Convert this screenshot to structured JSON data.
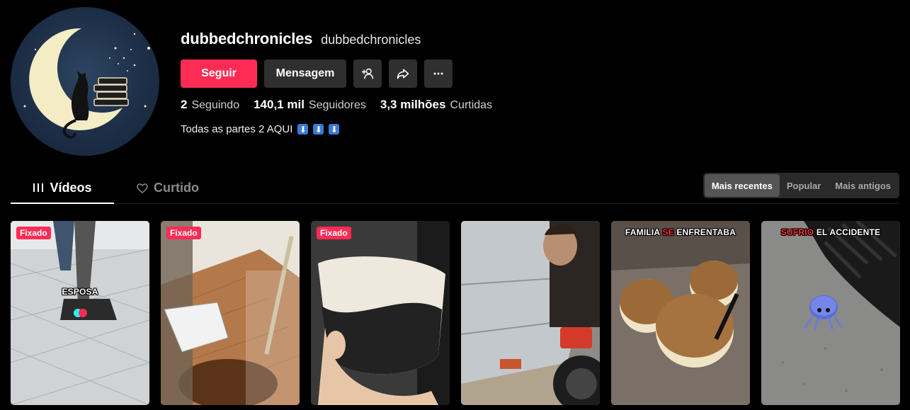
{
  "profile": {
    "username": "dubbedchronicles",
    "nickname": "dubbedchronicles",
    "follow_label": "Seguir",
    "message_label": "Mensagem",
    "stats": [
      {
        "value": "2",
        "label": "Seguindo"
      },
      {
        "value": "140,1 mil",
        "label": "Seguidores"
      },
      {
        "value": "3,3 milhões",
        "label": "Curtidas"
      }
    ],
    "bio": "Todas as partes 2 AQUI",
    "bio_arrows": [
      "⬇",
      "⬇",
      "⬇"
    ]
  },
  "tabs": {
    "videos": "Vídeos",
    "liked": "Curtido"
  },
  "sort": {
    "options": [
      "Mais recentes",
      "Popular",
      "Mais antigos"
    ],
    "active": "Mais recentes"
  },
  "videos": [
    {
      "pinned": "Fixado",
      "caption": "ESPOSA"
    },
    {
      "pinned": "Fixado"
    },
    {
      "pinned": "Fixado"
    },
    {},
    {
      "caption_parts": [
        "FAMILIA ",
        "SE",
        " ENFRENTABA"
      ]
    },
    {
      "caption_parts": [
        "SUFRIO",
        " EL ACCIDENTE"
      ]
    }
  ],
  "colors": {
    "accent": "#fe2c55",
    "button_bg": "#2f2f2f",
    "background": "#000000"
  }
}
